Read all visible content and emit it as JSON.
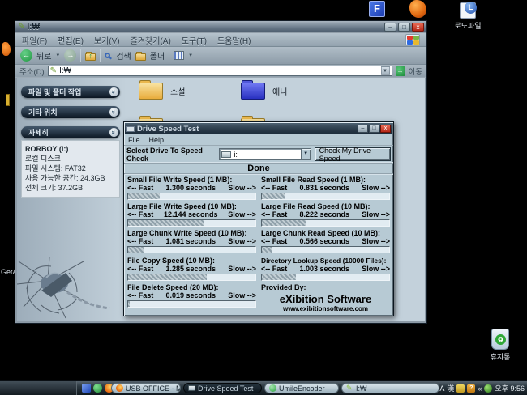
{
  "desktop": {
    "icon_f_label": "F",
    "lotto_label": "로또파일",
    "recycle_label": "휴지통",
    "recycle_glyph": "♻",
    "getasf_label": "GetAl"
  },
  "explorer": {
    "title": "I:₩",
    "pencil_glyph": "✎",
    "menus": [
      "파일(F)",
      "편집(E)",
      "보기(V)",
      "즐겨찾기(A)",
      "도구(T)",
      "도움말(H)"
    ],
    "window_buttons": {
      "minimize": "–",
      "maximize": "□",
      "close": "x"
    },
    "toolbar": {
      "back": "뒤로",
      "back_arrow": "←",
      "fwd_arrow": "→",
      "up_arrow": "↑",
      "search": "검색",
      "folders": "폴더",
      "dropdown": "▼"
    },
    "address": {
      "label": "주소(D)",
      "value": "I:₩",
      "dropdown": "▼",
      "go_arrow": "→",
      "go_label": "이동"
    },
    "sidebar": {
      "panel_file_tasks": "파일 및 폴더 작업",
      "panel_other_places": "기타 위치",
      "panel_details": "자세히",
      "chevron": "»",
      "details": {
        "drive_name": "RORBOY (I:)",
        "drive_type": "로컬 디스크",
        "filesystem": "파일 시스템: FAT32",
        "free_space": "사용 가능한 공간: 24.3GB",
        "total_size": "전체 크기: 37.2GB"
      }
    },
    "folders": {
      "novel": "소설",
      "anime": "애니"
    }
  },
  "speedtest": {
    "title": "Drive Speed Test",
    "menu_file": "File",
    "menu_help": "Help",
    "select_label": "Select Drive To Speed Check",
    "drive_value": "i:",
    "combo_arrow": "▼",
    "check_button": "Check My Drive Speed",
    "status": "Done",
    "fast": "<-- Fast",
    "slow": "Slow -->",
    "tests": [
      {
        "label": "Small File Write Speed (1 MB):",
        "value": "1.300 seconds",
        "pct": 25
      },
      {
        "label": "Small File Read Speed (1 MB):",
        "value": "0.831 seconds",
        "pct": 18
      },
      {
        "label": "Large File Write Speed (10 MB):",
        "value": "12.144 seconds",
        "pct": 60
      },
      {
        "label": "Large File Read Speed (10 MB):",
        "value": "8.222 seconds",
        "pct": 35
      },
      {
        "label": "Large Chunk Write Speed (10 MB):",
        "value": "1.081 seconds",
        "pct": 12
      },
      {
        "label": "Large Chunk Read Speed (10 MB):",
        "value": "0.566 seconds",
        "pct": 8
      },
      {
        "label": "File Copy Speed (10 MB):",
        "value": "1.285 seconds",
        "pct": 62
      },
      {
        "label": "Directory Lookup Speed (10000 Files):",
        "value": "1.003 seconds",
        "pct": 27
      },
      {
        "label": "File Delete Speed (20 MB):",
        "value": "0.019 seconds",
        "pct": 1
      }
    ],
    "provided": {
      "label": "Provided By:",
      "name": "eXibition Software",
      "url": "www.exibitionsoftware.com"
    }
  },
  "taskbar": {
    "quicklaunch_overflow": "»",
    "task_buttons": {
      "firefox": "USB OFFICE - Mozil...",
      "drivespeed": "Drive Speed Test",
      "encoder": "UmileEncoder",
      "explorer": "I:₩"
    },
    "tray": {
      "ime_en": "A",
      "ime_han": "漢",
      "help_badge": "?",
      "overflow": "«",
      "time": "오후 9:56"
    }
  },
  "colors": {
    "close_red": "#c23b2e",
    "go_green": "#1a8838",
    "folder_yellow": "#e8ac3c",
    "folder_blue": "#2830c0",
    "desktop_black": "#000000",
    "window_steel": "#b7cad4"
  }
}
